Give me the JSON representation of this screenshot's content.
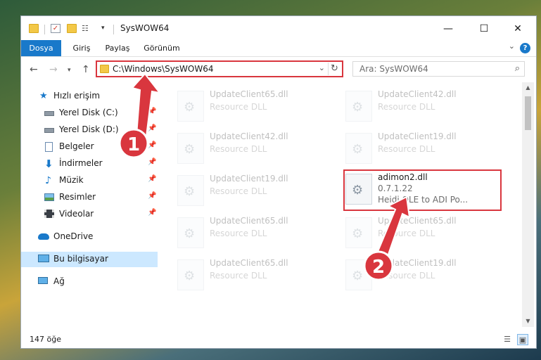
{
  "window": {
    "title": "SysWOW64"
  },
  "window_controls": {
    "minimize": "—",
    "maximize": "☐",
    "close": "✕"
  },
  "ribbon": {
    "tabs": [
      {
        "label": "Dosya"
      },
      {
        "label": "Giriş"
      },
      {
        "label": "Paylaş"
      },
      {
        "label": "Görünüm"
      }
    ],
    "help": "?"
  },
  "address": {
    "path": "C:\\Windows\\SysWOW64",
    "search_placeholder": "Ara: SysWOW64"
  },
  "nav": {
    "items": [
      {
        "label": "Hızlı erişim",
        "icon": "star-icon"
      },
      {
        "label": "Yerel Disk (C:)",
        "icon": "drive-icon",
        "pinned": true
      },
      {
        "label": "Yerel Disk (D:)",
        "icon": "drive-icon",
        "pinned": true
      },
      {
        "label": "Belgeler",
        "icon": "documents-icon",
        "pinned": true
      },
      {
        "label": "İndirmeler",
        "icon": "download-icon",
        "pinned": true
      },
      {
        "label": "Müzik",
        "icon": "music-icon",
        "pinned": true
      },
      {
        "label": "Resimler",
        "icon": "pictures-icon",
        "pinned": true
      },
      {
        "label": "Videolar",
        "icon": "videos-icon",
        "pinned": true
      },
      {
        "label": "OneDrive",
        "icon": "cloud-icon"
      },
      {
        "label": "Bu bilgisayar",
        "icon": "computer-icon",
        "selected": true
      },
      {
        "label": "Ağ",
        "icon": "network-icon"
      }
    ]
  },
  "files": [
    {
      "name": "UpdateClient65.dll",
      "meta": "Resource DLL"
    },
    {
      "name": "UpdateClient42.dll",
      "meta": "Resource DLL"
    },
    {
      "name": "UpdateClient42.dll",
      "meta": "Resource DLL"
    },
    {
      "name": "UpdateClient19.dll",
      "meta": "Resource DLL"
    },
    {
      "name": "UpdateClient19.dll",
      "meta": "Resource DLL"
    },
    {
      "name": "adimon2.dll",
      "version": "0.7.1.22",
      "meta": "Heidi OLE to ADI Po..."
    },
    {
      "name": "UpdateClient65.dll",
      "meta": "Resource DLL"
    },
    {
      "name": "UpdateClient65.dll",
      "meta": "Resource DLL"
    },
    {
      "name": "UpdateClient65.dll",
      "meta": "Resource DLL"
    },
    {
      "name": "UpdateClient19.dll",
      "meta": "Resource DLL"
    }
  ],
  "status": {
    "count": "147 öğe"
  },
  "annotations": [
    {
      "label": "1"
    },
    {
      "label": "2"
    }
  ],
  "colors": {
    "accent": "#1979ca",
    "annotation_red": "#d9363e",
    "selection": "#cce8ff"
  }
}
